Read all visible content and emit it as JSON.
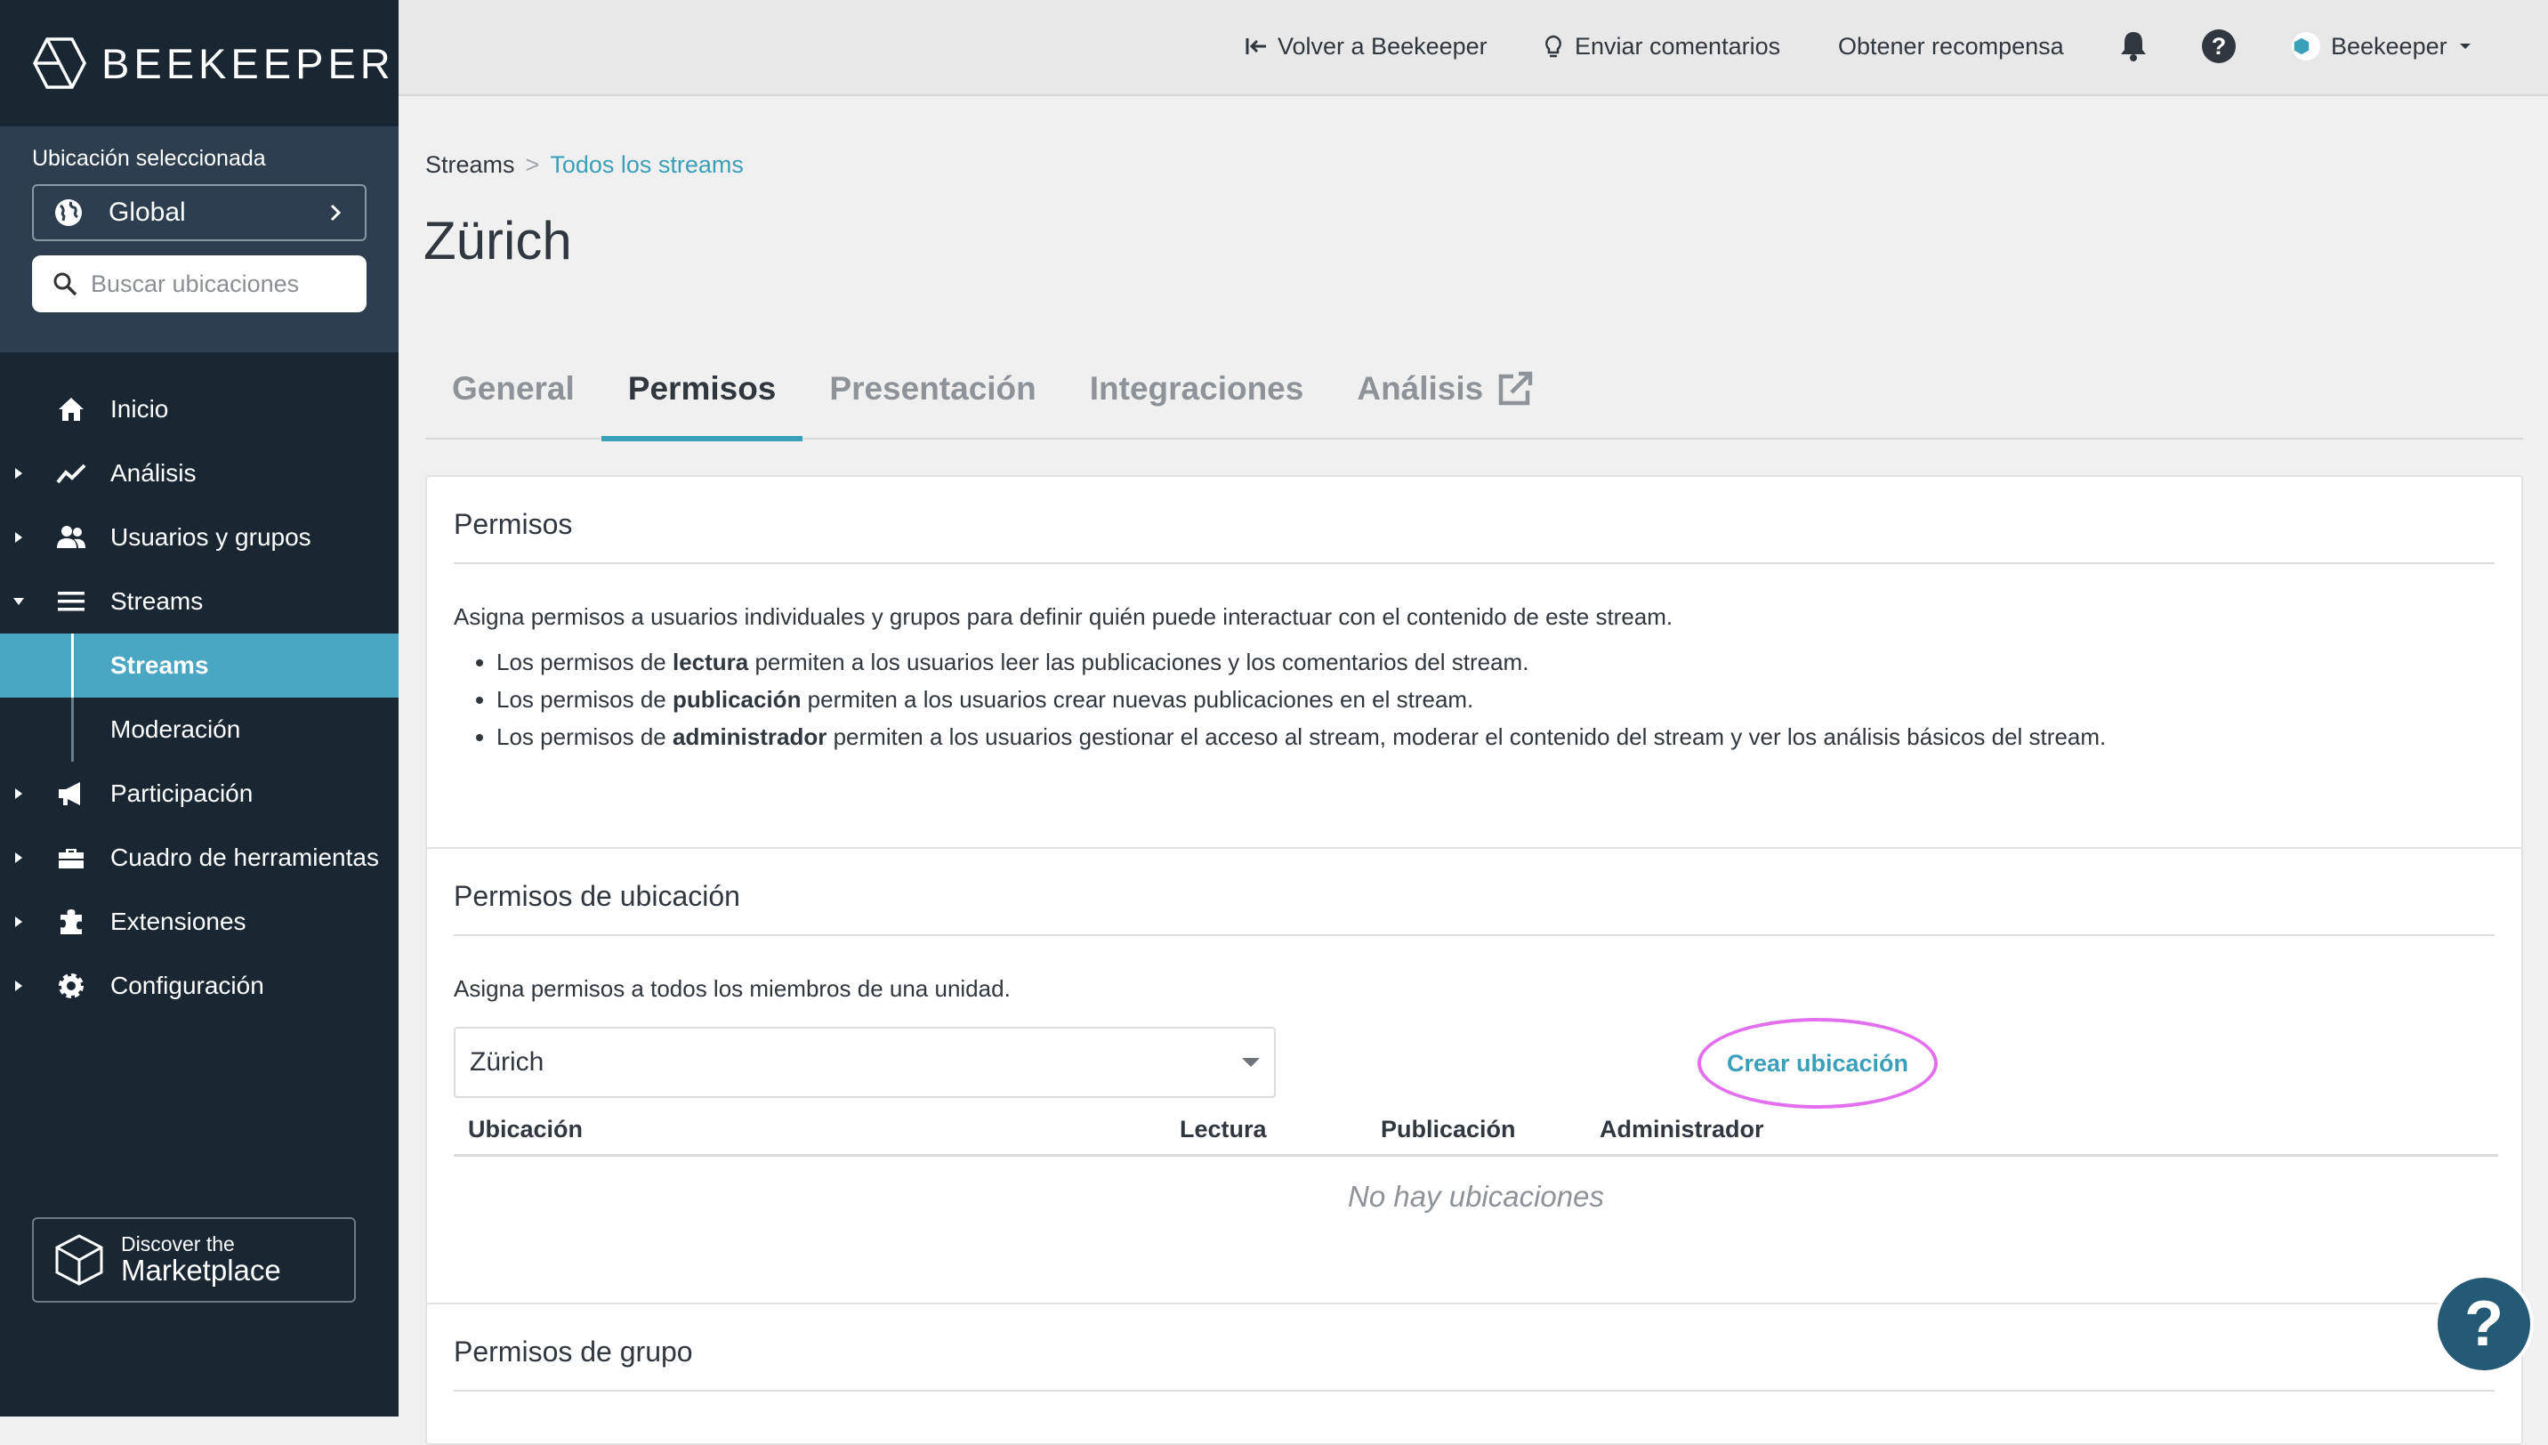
{
  "brand": {
    "name": "BEEKEEPER"
  },
  "sidebar": {
    "location_label": "Ubicación seleccionada",
    "location_value": "Global",
    "search_placeholder": "Buscar ubicaciones",
    "items": [
      {
        "label": "Inicio",
        "icon": "home-icon"
      },
      {
        "label": "Análisis",
        "icon": "chart-line-icon"
      },
      {
        "label": "Usuarios y grupos",
        "icon": "users-icon"
      },
      {
        "label": "Streams",
        "icon": "list-icon"
      },
      {
        "label": "Participación",
        "icon": "megaphone-icon"
      },
      {
        "label": "Cuadro de herramientas",
        "icon": "toolbox-icon"
      },
      {
        "label": "Extensiones",
        "icon": "puzzle-icon"
      },
      {
        "label": "Configuración",
        "icon": "gear-icon"
      }
    ],
    "sub_items": [
      {
        "label": "Streams"
      },
      {
        "label": "Moderación"
      }
    ],
    "marketplace": {
      "small": "Discover the",
      "big": "Marketplace"
    }
  },
  "topbar": {
    "back": "Volver a Beekeeper",
    "feedback": "Enviar comentarios",
    "reward": "Obtener recompensa",
    "user": "Beekeeper"
  },
  "main": {
    "breadcrumb": {
      "root": "Streams",
      "sep": ">",
      "current": "Todos los streams"
    },
    "title": "Zürich",
    "tabs": [
      "General",
      "Permisos",
      "Presentación",
      "Integraciones",
      "Análisis"
    ],
    "permissions": {
      "title": "Permisos",
      "intro": "Asigna permisos a usuarios individuales y grupos para definir quién puede interactuar con el contenido de este stream.",
      "bullets": [
        {
          "pre": "Los permisos de ",
          "bold": "lectura",
          "post": " permiten a los usuarios leer las publicaciones y los comentarios del stream."
        },
        {
          "pre": "Los permisos de ",
          "bold": "publicación",
          "post": " permiten a los usuarios crear nuevas publicaciones en el stream."
        },
        {
          "pre": "Los permisos de ",
          "bold": "administrador",
          "post": " permiten a los usuarios gestionar el acceso al stream, moderar el contenido del stream y ver los análisis básicos del stream."
        }
      ]
    },
    "location_permissions": {
      "title": "Permisos de ubicación",
      "desc": "Asigna permisos a todos los miembros de una unidad.",
      "dropdown_value": "Zürich",
      "create_button": "Crear ubicación",
      "columns": [
        "Ubicación",
        "Lectura",
        "Publicación",
        "Administrador"
      ],
      "empty": "No hay ubicaciones"
    },
    "group_permissions": {
      "title": "Permisos de grupo"
    }
  },
  "help": {
    "label": "?"
  },
  "colors": {
    "accent": "#3a9fb9",
    "sidebar": "#1a2733",
    "highlight": "#e46ef0"
  }
}
